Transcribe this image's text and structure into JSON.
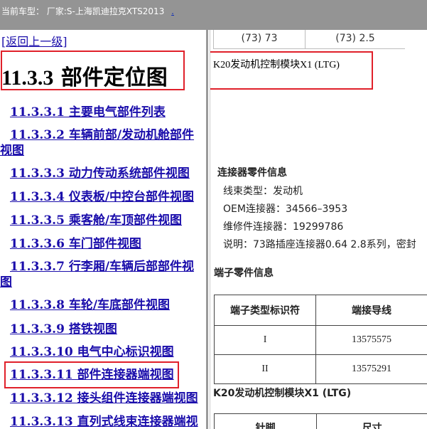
{
  "header": {
    "prefix": "当前车型：",
    "vehicle": "厂家:S-上海凯迪拉克XTS2013",
    "link": "."
  },
  "left": {
    "back": "[返回上一级]",
    "title_num": "11.3.3",
    "title_text": " 部件定位图",
    "items": [
      "11.3.3.1 主要电气部件列表",
      "11.3.3.2 车辆前部/发动机舱部件视图",
      "11.3.3.3 动力传动系统部件视图",
      "11.3.3.4 仪表板/中控台部件视图",
      "11.3.3.5 乘客舱/车顶部件视图",
      "11.3.3.6 车门部件视图",
      "11.3.3.7 行李厢/车辆后部部件视图",
      "11.3.3.8 车轮/车底部件视图",
      "11.3.3.9 搭铁视图",
      "11.3.3.10 电气中心标识视图",
      "11.3.3.11 部件连接器端视图",
      "11.3.3.12 接头组件连接器端视图",
      "11.3.3.13 直列式线束连接器端视"
    ]
  },
  "right": {
    "top_row": [
      "(73) 73",
      "(73) 2.5"
    ],
    "module_title_1": "K20发动机控制模块X1 (LTG)",
    "connector_heading": "连接器零件信息",
    "connector_info": [
      "线束类型：发动机",
      "OEM连接器：34566–3953",
      "维修件连接器：19299786",
      "说明：73路插座连接器0.64 2.8系列，密封"
    ],
    "terminal_heading": "端子零件信息",
    "terminal_table": {
      "headers": [
        "端子类型标识符",
        "端接导线"
      ],
      "rows": [
        [
          "I",
          "13575575"
        ],
        [
          "II",
          "13575291"
        ]
      ]
    },
    "module_title_2": "K20发动机控制模块X1 (LTG)",
    "pin_headers": [
      "针脚",
      "尺寸"
    ]
  },
  "colors": {
    "link": "#1a0dab",
    "highlight": "#e0202a",
    "topbar": "#949494"
  }
}
